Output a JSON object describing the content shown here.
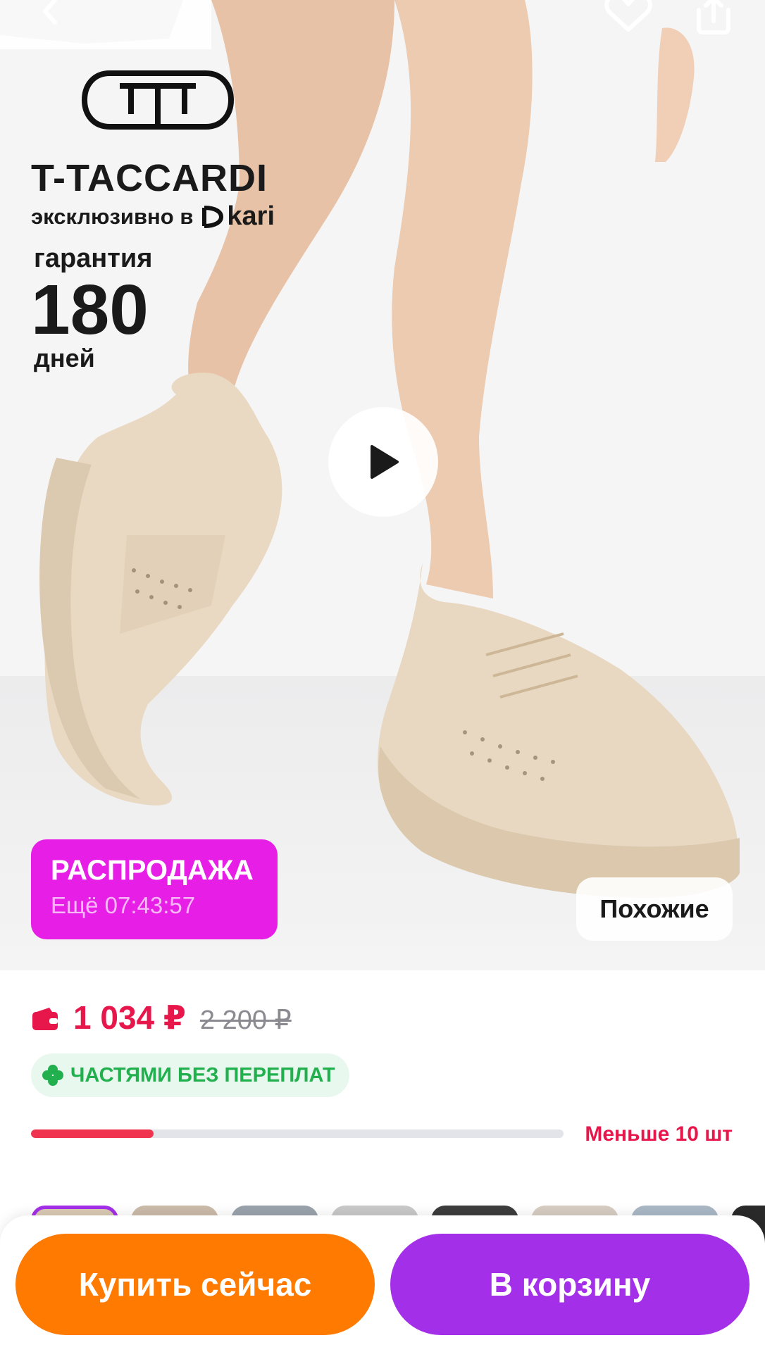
{
  "hero": {
    "brand_name": "T-TACCARDI",
    "exclusive_text": "эксклюзивно в",
    "partner_logo_text": "kari",
    "guarantee_label": "гарантия",
    "guarantee_value": "180",
    "guarantee_unit": "дней",
    "icons": [
      "back-arrow-icon",
      "heart-icon",
      "share-icon",
      "play-icon"
    ]
  },
  "sale_badge": {
    "title": "РАСПРОДАЖА",
    "timer": "Ещё 07:43:57"
  },
  "similar_button": {
    "label": "Похожие"
  },
  "price": {
    "current": "1 034 ₽",
    "old": "2 200 ₽",
    "wallet_color": "#e8174b"
  },
  "installment": {
    "label": "ЧАСТЯМИ БЕЗ ПЕРЕПЛАТ"
  },
  "stock": {
    "label": "Меньше 10 шт",
    "level": 0.23
  },
  "actions": {
    "buy_now": "Купить сейчас",
    "add_to_cart": "В корзину"
  },
  "colors": {
    "buy": "#ff7a00",
    "cart": "#a42fe8",
    "sale": "#e61ee6",
    "price": "#e8174b",
    "installment": "#22b04f"
  }
}
